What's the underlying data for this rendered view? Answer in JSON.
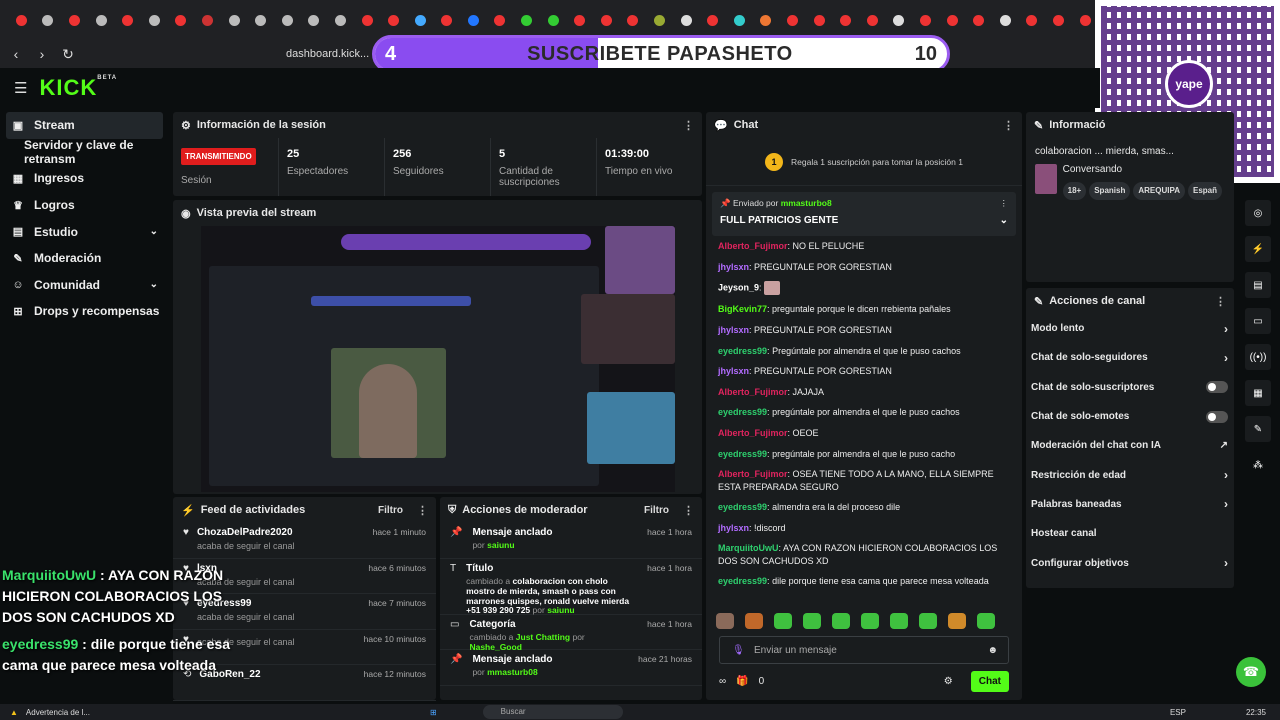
{
  "browser": {
    "url": "dashboard.kick..."
  },
  "overlay": {
    "left_number": "4",
    "text": "SUSCRIBETE PAPASHETO",
    "right_number": "10",
    "progress": 0.39
  },
  "brand": {
    "logo": "KICK",
    "beta": "BETA",
    "accent": "#53fc18"
  },
  "sidebar": {
    "items": [
      {
        "label": "Stream",
        "icon": "video-icon"
      },
      {
        "label": "Servidor y clave de retransm"
      },
      {
        "label": "Ingresos",
        "icon": "grid-icon"
      },
      {
        "label": "Logros",
        "icon": "trophy-icon"
      },
      {
        "label": "Estudio",
        "icon": "layout-icon"
      },
      {
        "label": "Moderación",
        "icon": "wrench-icon"
      },
      {
        "label": "Comunidad",
        "icon": "people-icon"
      },
      {
        "label": "Drops y recompensas",
        "icon": "gift-icon"
      }
    ]
  },
  "session": {
    "title": "Información de la sesión",
    "badge": "TRANSMITIENDO",
    "badge_label": "Sesión",
    "stats": [
      {
        "value": "25",
        "label": "Espectadores"
      },
      {
        "value": "256",
        "label": "Seguidores"
      },
      {
        "value": "5",
        "label": "Cantidad de suscripciones"
      },
      {
        "value": "01:39:00",
        "label": "Tiempo en vivo"
      }
    ]
  },
  "preview": {
    "title": "Vista previa del stream"
  },
  "feed": {
    "title": "Feed de actividades",
    "filter": "Filtro",
    "rows": [
      {
        "user": "ChozaDelPadre2020",
        "sub": "acaba de seguir el canal",
        "time": "hace 1 minuto"
      },
      {
        "user": "lsxn",
        "sub": "acaba de seguir el canal",
        "time": "hace 6 minutos"
      },
      {
        "user": "eyedress99",
        "sub": "acaba de seguir el canal",
        "time": "hace 7 minutos"
      },
      {
        "user": "",
        "sub": "acaba de seguir el canal",
        "time": "hace 10 minutos"
      },
      {
        "user": "GaboRen_22",
        "sub": "",
        "time": "hace 12 minutos"
      }
    ]
  },
  "modactions": {
    "title": "Acciones de moderador",
    "filter": "Filtro",
    "rows": [
      {
        "title": "Mensaje anclado",
        "sub": "por",
        "user": "saiunu",
        "time": "hace 1 hora"
      },
      {
        "title": "Título",
        "sub": "cambiado a",
        "detail": "colaboracion con cholo mostro de mierda, smash o pass con marrones quispes, ronald vuelve mierda +51 939 290 725",
        "by": "por",
        "user": "saiunu",
        "time": "hace 1 hora"
      },
      {
        "title": "Categoría",
        "sub": "cambiado a",
        "detail": "Just Chatting",
        "by": "por",
        "user": "Nashe_Good",
        "time": "hace 1 hora"
      },
      {
        "title": "Mensaje anclado",
        "sub": "por",
        "user": "mmasturb08",
        "time": "hace 21 horas"
      }
    ]
  },
  "chat": {
    "title": "Chat",
    "gift_text": "Regala 1 suscripción para tomar la posición 1",
    "gift_num": "1",
    "pinned": {
      "by_label": "Enviado por",
      "by": "mmasturbo8",
      "msg": "FULL PATRICIOS GENTE"
    },
    "messages": [
      {
        "user": "Alberto_Fujimor",
        "text": "NO EL PELUCHE",
        "color": "#e0245e"
      },
      {
        "user": "jhylsxn",
        "text": "PREGUNTALE POR GORESTIAN",
        "color": "#b26cff"
      },
      {
        "user": "Jeyson_9",
        "text": "",
        "color": "#ffffff"
      },
      {
        "user": "BigKevin77",
        "text": "preguntale porque le dicen rrebienta pañales",
        "color": "#53fc18"
      },
      {
        "user": "jhylsxn",
        "text": "PREGUNTALE POR GORESTIAN",
        "color": "#b26cff"
      },
      {
        "user": "eyedress99",
        "text": "Pregúntale por almendra el que le puso cachos",
        "color": "#2ed06e"
      },
      {
        "user": "jhylsxn",
        "text": "PREGUNTALE POR GORESTIAN",
        "color": "#b26cff"
      },
      {
        "user": "Alberto_Fujimor",
        "text": "JAJAJA",
        "color": "#e0245e"
      },
      {
        "user": "eyedress99",
        "text": "pregúntale por almendra el que le puso cachos",
        "color": "#2ed06e"
      },
      {
        "user": "Alberto_Fujimor",
        "text": "OEOE",
        "color": "#e0245e"
      },
      {
        "user": "eyedress99",
        "text": "pregúntale por almendra el que le puso cacho",
        "color": "#2ed06e"
      },
      {
        "user": "Alberto_Fujimor",
        "text": "OSEA TIENE TODO A LA MANO, ELLA SIEMPRE ESTA PREPARADA SEGURO",
        "color": "#e0245e"
      },
      {
        "user": "eyedress99",
        "text": "almendra era la del proceso dile",
        "color": "#2ed06e"
      },
      {
        "user": "jhylsxn",
        "text": "!discord",
        "color": "#b26cff"
      },
      {
        "user": "MarquiitoUwU",
        "text": "AYA CON RAZON HICIERON COLABORACIOS LOS DOS SON CACHUDOS XD",
        "color": "#2ed06e"
      },
      {
        "user": "eyedress99",
        "text": "dile porque tiene esa cama que parece mesa volteada",
        "color": "#2ed06e"
      }
    ],
    "input_placeholder": "Enviar un mensaje",
    "points": "0",
    "send": "Chat"
  },
  "info": {
    "title": "Informació",
    "text": "colaboracion ... mierda, smas...",
    "status": "Conversando",
    "tags": [
      "18+",
      "Spanish",
      "AREQUIPA",
      "Españ"
    ]
  },
  "channel_actions": {
    "title": "Acciones de canal",
    "items": [
      {
        "label": "Modo lento",
        "kind": "arrow"
      },
      {
        "label": "Chat de solo-seguidores",
        "kind": "arrow"
      },
      {
        "label": "Chat de solo-suscriptores",
        "kind": "toggle"
      },
      {
        "label": "Chat de solo-emotes",
        "kind": "toggle"
      },
      {
        "label": "Moderación del chat con IA",
        "kind": "ext"
      },
      {
        "label": "Restricción de edad",
        "kind": "arrow"
      },
      {
        "label": "Palabras baneadas",
        "kind": "arrow"
      },
      {
        "label": "Hostear canal",
        "kind": "none"
      },
      {
        "label": "Configurar objetivos",
        "kind": "arrow"
      }
    ]
  },
  "overlay_chat": [
    {
      "user": "MarquiitoUwU",
      "text": "AYA CON RAZON HICIERON COLABORACIOS LOS DOS SON CACHUDOS XD"
    },
    {
      "user": "eyedress99",
      "text": "dile porque tiene esa cama que parece mesa volteada"
    }
  ],
  "taskbar": {
    "warning": "Advertencia de l...",
    "search": "Buscar",
    "lang": "ESP",
    "time": "22:35"
  }
}
